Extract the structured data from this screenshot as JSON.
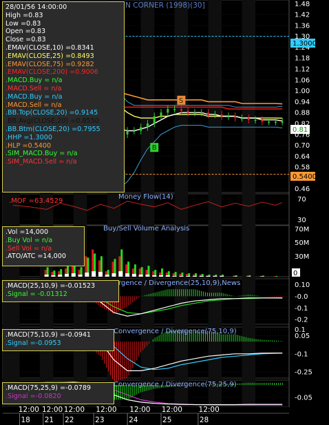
{
  "title_fragment": "N CORNER (1998)(30]",
  "info_main": {
    "lines": [
      {
        "text": "28/01/56 14:00:00",
        "color": "#ffffff"
      },
      {
        "text": "High  =0.83",
        "color": "#ffffff"
      },
      {
        "text": "Low  =0.83",
        "color": "#ffffff"
      },
      {
        "text": "Open  =0.83",
        "color": "#ffffff"
      },
      {
        "text": "Close  =0.83",
        "color": "#ffffff"
      },
      {
        "text": ".EMAV(CLOSE,10)  =0.8341",
        "color": "#ffffff"
      },
      {
        "text": ".EMAV(CLOSE,25)  =0.8493",
        "color": "#ffff66"
      },
      {
        "text": ".EMAV(CLOSE,75)  =0.9282",
        "color": "#ff9933"
      },
      {
        "text": ".EMAV(CLOSE,200)  =0.9006",
        "color": "#ff2222"
      },
      {
        "text": ".MACD.Buy  = n/a",
        "color": "#33ff33"
      },
      {
        "text": ".MACD.Sell  = n/a",
        "color": "#ff3333"
      },
      {
        "text": ".MACD.Buy  = n/a",
        "color": "#33ccff"
      },
      {
        "text": ".MACD.Sell  = n/a",
        "color": "#ff9933"
      },
      {
        "text": ".BB.Top(CLOSE,20)  =0.9145",
        "color": "#33ccff"
      },
      {
        "text": ".BB.Avg(CLOSE,20)  =0.8550",
        "color": "#111111"
      },
      {
        "text": ".BB.Btm(CLOSE,20)  =0.7955",
        "color": "#33ccff"
      },
      {
        "text": ".HHP  =1.3000",
        "color": "#33ccff"
      },
      {
        "text": ".HLP  =0.5400",
        "color": "#ff9933"
      },
      {
        "text": ".SIM_MACD.Buy  = n/a",
        "color": "#33ff33"
      },
      {
        "text": ".SIM_MACD.Sell  = n/a",
        "color": "#ff3333"
      }
    ]
  },
  "mfi_panel": {
    "title": "Money Flow(14)",
    "readout": ".MOF  =63.4529",
    "readout_color": "#ff3333"
  },
  "vol_panel": {
    "title": "Buy/Sell Volume Analysis",
    "lines": [
      {
        "text": ".Vol  =14,000",
        "color": "#ffffff"
      },
      {
        "text": ".Buy Vol  = n/a",
        "color": "#33ff33"
      },
      {
        "text": ".Sell Vol  = n/a",
        "color": "#ff3333"
      },
      {
        "text": ".ATO/ATC  =14,000",
        "color": "#ffffff"
      }
    ]
  },
  "macd1": {
    "title": "rgence / Divergence(25,10,9),News",
    "lines": [
      {
        "text": ".MACD(25,10,9)  =-0.01523",
        "color": "#ffffff"
      },
      {
        "text": ".Signal  = -0.01312",
        "color": "#33ff33"
      }
    ]
  },
  "macd2": {
    "title": "Convergence / Divergence(75,10,9)",
    "lines": [
      {
        "text": ".MACD(75,10,9)  =-0.0941",
        "color": "#ffffff"
      },
      {
        "text": ".Signal  =-0.0953",
        "color": "#33ccff"
      }
    ]
  },
  "macd3": {
    "title": "Convergence / Divergence(75,25,9)",
    "lines": [
      {
        "text": ".MACD(75,25,9)  =-0.0789",
        "color": "#ffffff"
      },
      {
        "text": ".Signal  =-0.0820",
        "color": "#cc33cc"
      }
    ]
  },
  "badges": {
    "hhp": "1.3000",
    "last": "0.81",
    "hlp": "0.5400"
  },
  "signals": [
    {
      "label": "S",
      "x": 23.1,
      "price": 1.35,
      "kind": "sell"
    },
    {
      "label": "B",
      "x": 22.1,
      "price": 0.99,
      "kind": "buy-cyan"
    },
    {
      "label": "B",
      "x": 24.0,
      "price": 0.54,
      "kind": "buy-cyan"
    },
    {
      "label": "B",
      "x": 25.0,
      "price": 0.69,
      "kind": "buy-green"
    },
    {
      "label": "S",
      "x": 25.8,
      "price": 0.95,
      "kind": "sell"
    }
  ],
  "chart_data": [
    {
      "type": "line",
      "name": "price",
      "ylim": [
        0.44,
        1.5
      ],
      "ticks": [
        "1.48",
        "1.42",
        "1.36",
        "1.30",
        "1.24",
        "1.18",
        "1.12",
        "1.06",
        "1.00",
        "0.94",
        "0.88",
        "0.82",
        "0.76",
        "0.70",
        "0.64",
        "0.58",
        "0.52",
        "0.46"
      ],
      "x": [
        22.0,
        22.2,
        22.4,
        22.6,
        22.8,
        23.0,
        23.2,
        23.4,
        23.6,
        23.8,
        24.0,
        24.2,
        24.4,
        24.6,
        24.8,
        25.0,
        25.2,
        25.4,
        25.6,
        25.8,
        26.0,
        26.2,
        26.4,
        26.6,
        26.8,
        27.0,
        27.2,
        27.4,
        27.6,
        27.8,
        28.0,
        28.2,
        28.4,
        28.6,
        28.8
      ],
      "close": [
        1.2,
        1.23,
        1.25,
        1.24,
        1.18,
        1.15,
        1.05,
        0.88,
        0.62,
        0.66,
        0.76,
        0.78,
        0.78,
        0.8,
        0.82,
        0.86,
        0.88,
        0.9,
        0.9,
        0.89,
        0.88,
        0.88,
        0.88,
        0.87,
        0.87,
        0.86,
        0.86,
        0.85,
        0.85,
        0.84,
        0.84,
        0.83,
        0.83,
        0.83,
        0.83
      ],
      "ema10": [
        1.2,
        1.21,
        1.22,
        1.22,
        1.21,
        1.19,
        1.15,
        1.06,
        0.92,
        0.82,
        0.79,
        0.78,
        0.78,
        0.79,
        0.8,
        0.82,
        0.84,
        0.86,
        0.87,
        0.88,
        0.88,
        0.88,
        0.88,
        0.87,
        0.87,
        0.86,
        0.86,
        0.86,
        0.85,
        0.85,
        0.85,
        0.84,
        0.84,
        0.84,
        0.834
      ],
      "ema25": [
        1.16,
        1.17,
        1.18,
        1.18,
        1.18,
        1.17,
        1.14,
        1.09,
        1.01,
        0.95,
        0.91,
        0.88,
        0.86,
        0.85,
        0.85,
        0.85,
        0.86,
        0.86,
        0.87,
        0.87,
        0.87,
        0.87,
        0.87,
        0.86,
        0.86,
        0.86,
        0.86,
        0.86,
        0.85,
        0.85,
        0.85,
        0.85,
        0.85,
        0.85,
        0.849
      ],
      "ema75": [
        1.08,
        1.09,
        1.1,
        1.1,
        1.1,
        1.1,
        1.09,
        1.07,
        1.04,
        1.01,
        0.99,
        0.98,
        0.97,
        0.96,
        0.95,
        0.95,
        0.95,
        0.95,
        0.95,
        0.95,
        0.95,
        0.95,
        0.95,
        0.94,
        0.94,
        0.94,
        0.94,
        0.94,
        0.93,
        0.93,
        0.93,
        0.93,
        0.93,
        0.93,
        0.928
      ],
      "ema200": [
        0.91,
        0.91,
        0.92,
        0.92,
        0.92,
        0.92,
        0.92,
        0.92,
        0.92,
        0.91,
        0.91,
        0.91,
        0.91,
        0.91,
        0.91,
        0.91,
        0.91,
        0.91,
        0.91,
        0.91,
        0.91,
        0.91,
        0.91,
        0.91,
        0.91,
        0.91,
        0.9,
        0.9,
        0.9,
        0.9,
        0.9,
        0.9,
        0.9,
        0.9,
        0.9006
      ],
      "bb_top": [
        1.4,
        1.45,
        1.48,
        1.48,
        1.47,
        1.46,
        1.4,
        1.3,
        1.18,
        1.06,
        0.98,
        0.94,
        0.92,
        0.92,
        0.92,
        0.92,
        0.92,
        0.92,
        0.92,
        0.92,
        0.92,
        0.92,
        0.92,
        0.92,
        0.92,
        0.92,
        0.92,
        0.91,
        0.91,
        0.91,
        0.91,
        0.91,
        0.91,
        0.91,
        0.9145
      ],
      "bb_btm": [
        1.02,
        1.02,
        1.03,
        1.02,
        1.0,
        0.98,
        0.9,
        0.75,
        0.55,
        0.48,
        0.47,
        0.5,
        0.55,
        0.62,
        0.68,
        0.72,
        0.76,
        0.78,
        0.8,
        0.81,
        0.81,
        0.81,
        0.81,
        0.8,
        0.8,
        0.8,
        0.8,
        0.8,
        0.8,
        0.8,
        0.8,
        0.8,
        0.8,
        0.8,
        0.7955
      ],
      "hhp": 1.3,
      "hlp": 0.54
    },
    {
      "type": "line",
      "name": "Money Flow(14)",
      "ylim": [
        20,
        80
      ],
      "ticks": [
        "70",
        "30"
      ],
      "x": [
        20.8,
        21.3,
        21.8,
        22.2,
        22.6,
        23.0,
        23.4,
        23.8,
        24.2,
        24.6,
        25.0,
        25.4,
        25.8,
        26.2,
        26.6,
        27.0,
        27.4,
        27.8,
        28.2,
        28.6,
        28.8
      ],
      "values": [
        58,
        55,
        50,
        62,
        56,
        48,
        60,
        52,
        66,
        60,
        55,
        63,
        50,
        58,
        65,
        55,
        62,
        56,
        64,
        58,
        63.45
      ]
    },
    {
      "type": "bar",
      "name": "Buy/Sell Volume Analysis",
      "ylim": [
        0,
        75000000
      ],
      "ticks": [
        "70M",
        "50M",
        "30M"
      ],
      "x": [
        21.8,
        22.0,
        22.2,
        22.4,
        22.6,
        22.8,
        23.0,
        23.2,
        23.4,
        23.6,
        23.8,
        24.0,
        24.2,
        24.4,
        24.6,
        24.8,
        25.0,
        25.2,
        25.4,
        25.6,
        25.8,
        26.0,
        26.2,
        26.4,
        26.6,
        26.8,
        27.0,
        27.4,
        27.8,
        28.2,
        28.6
      ],
      "buy": [
        14000000,
        9000000,
        11000000,
        16000000,
        20000000,
        14000000,
        28000000,
        34000000,
        30000000,
        10000000,
        26000000,
        40000000,
        22000000,
        18000000,
        14000000,
        16000000,
        10000000,
        12000000,
        8000000,
        7000000,
        6000000,
        5000000,
        5000000,
        4000000,
        3000000,
        3000000,
        3000000,
        2000000,
        2000000,
        1500000,
        1000000
      ],
      "sell": [
        10000000,
        7000000,
        8000000,
        12000000,
        18000000,
        10000000,
        30000000,
        40000000,
        24000000,
        8000000,
        22000000,
        30000000,
        18000000,
        12000000,
        12000000,
        10000000,
        8000000,
        6000000,
        6000000,
        5000000,
        4000000,
        4000000,
        3000000,
        3000000,
        2000000,
        2000000,
        2000000,
        1500000,
        1500000,
        1000000,
        800000
      ],
      "ato": [
        3000000,
        2000000,
        3000000,
        4000000,
        5000000,
        3000000,
        6000000,
        8000000,
        7000000,
        3000000,
        5000000,
        8000000,
        5000000,
        4000000,
        3000000,
        3000000,
        2000000,
        2000000,
        2000000,
        1000000,
        1000000,
        1000000,
        1000000,
        1000000,
        1000000,
        1000000,
        1000000,
        500000,
        500000,
        500000,
        14000
      ]
    },
    {
      "type": "line",
      "name": "MACD(25,10,9)",
      "ylim": [
        -0.24,
        0.15
      ],
      "ticks": [
        "0.10",
        "-0.0",
        "-0.1",
        "-0.2"
      ],
      "x": [
        20.8,
        21.3,
        21.8,
        22.2,
        22.6,
        23.0,
        23.4,
        23.8,
        24.2,
        24.6,
        25.0,
        25.4,
        25.8,
        26.2,
        26.6,
        27.0,
        27.4,
        27.8,
        28.2,
        28.6,
        28.8
      ],
      "macd": [
        0,
        0,
        0.005,
        0.02,
        0.03,
        0.02,
        -0.05,
        -0.14,
        -0.17,
        -0.15,
        -0.12,
        -0.09,
        -0.06,
        -0.04,
        -0.03,
        -0.02,
        -0.02,
        -0.015,
        -0.015,
        -0.015,
        -0.01523
      ],
      "signal": [
        0,
        0,
        0,
        0.01,
        0.02,
        0.02,
        -0.02,
        -0.09,
        -0.14,
        -0.15,
        -0.13,
        -0.11,
        -0.08,
        -0.06,
        -0.04,
        -0.03,
        -0.02,
        -0.02,
        -0.015,
        -0.013,
        -0.01312
      ]
    },
    {
      "type": "line",
      "name": "MACD(75,10,9)",
      "ylim": [
        -0.3,
        0.12
      ],
      "ticks": [
        "0.1",
        "0.05",
        "-0.1",
        "-0.25"
      ],
      "x": [
        20.8,
        21.3,
        21.8,
        22.2,
        22.6,
        23.0,
        23.4,
        23.8,
        24.2,
        24.6,
        25.0,
        25.4,
        25.8,
        26.2,
        26.6,
        27.0,
        27.4,
        27.8,
        28.2,
        28.6,
        28.8
      ],
      "macd": [
        0.04,
        0.05,
        0.06,
        0.07,
        0.08,
        0.06,
        0.0,
        -0.15,
        -0.24,
        -0.24,
        -0.22,
        -0.19,
        -0.16,
        -0.14,
        -0.12,
        -0.11,
        -0.1,
        -0.1,
        -0.095,
        -0.094,
        -0.0941
      ],
      "signal": [
        0.03,
        0.04,
        0.05,
        0.06,
        0.07,
        0.07,
        0.04,
        -0.04,
        -0.14,
        -0.21,
        -0.23,
        -0.22,
        -0.19,
        -0.17,
        -0.15,
        -0.13,
        -0.12,
        -0.11,
        -0.1,
        -0.097,
        -0.0953
      ]
    },
    {
      "type": "line",
      "name": "MACD(75,25,9)",
      "ylim": [
        -0.09,
        0.02
      ],
      "ticks": [
        "-0.05"
      ],
      "x": [
        20.8,
        21.3,
        21.8,
        22.2,
        22.6,
        23.0,
        23.4,
        23.8,
        24.2,
        24.6,
        25.0,
        25.4,
        25.8,
        26.2,
        26.6,
        27.0,
        27.4,
        27.8,
        28.2,
        28.6,
        28.8
      ],
      "macd": [
        0.0,
        0.0,
        0.005,
        0.01,
        0.012,
        0.008,
        -0.01,
        -0.04,
        -0.06,
        -0.07,
        -0.075,
        -0.078,
        -0.079,
        -0.08,
        -0.08,
        -0.08,
        -0.08,
        -0.079,
        -0.079,
        -0.079,
        -0.0789
      ],
      "signal": [
        0.0,
        0.0,
        0.0,
        0.005,
        0.01,
        0.01,
        0.0,
        -0.02,
        -0.04,
        -0.06,
        -0.07,
        -0.075,
        -0.078,
        -0.08,
        -0.081,
        -0.082,
        -0.082,
        -0.082,
        -0.082,
        -0.082,
        -0.082
      ]
    }
  ],
  "x_axis": {
    "time_labels": [
      "12:00",
      "12:00",
      "12:00",
      "12:00",
      "12:00",
      "12:00",
      "12:00"
    ],
    "day_labels": [
      "18",
      "21",
      "22",
      "23",
      "24",
      "25",
      "28"
    ]
  }
}
